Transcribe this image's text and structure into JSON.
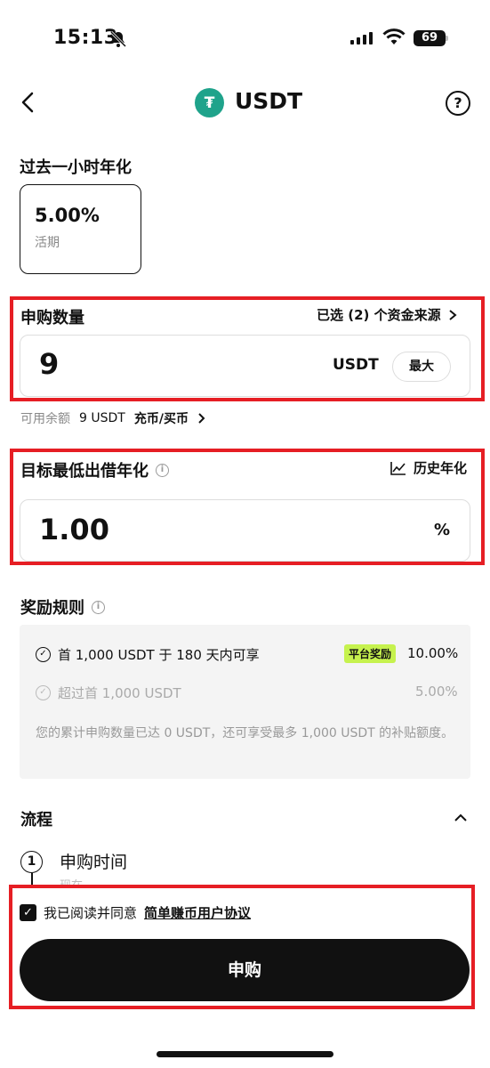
{
  "status_bar": {
    "time": "15:13",
    "battery": "69"
  },
  "header": {
    "title": "USDT",
    "logo_glyph": "₮"
  },
  "rate": {
    "label": "过去一小时年化",
    "value": "5.00%",
    "type": "活期"
  },
  "subscribe": {
    "label": "申购数量",
    "source_link": "已选 (2) 个资金来源",
    "amount": "9",
    "unit": "USDT",
    "max_label": "最大",
    "balance_label": "可用余额",
    "balance_value": "9 USDT",
    "deposit_link": "充币/买币"
  },
  "target": {
    "label": "目标最低出借年化",
    "history_link": "历史年化",
    "value": "1.00",
    "unit": "%"
  },
  "rewards": {
    "label": "奖励规则",
    "row1_text": "首 1,000 USDT 于 180 天内可享",
    "badge": "平台奖励",
    "row1_rate": "10.00%",
    "row2_text": "超过首 1,000 USDT",
    "row2_rate": "5.00%",
    "note": "您的累计申购数量已达 0 USDT，还可享受最多 1,000 USDT 的补贴额度。"
  },
  "flow": {
    "label": "流程",
    "step_number": "1",
    "step_title": "申购时间",
    "step_sub": "现在"
  },
  "agreement": {
    "prefix": "我已阅读并同意",
    "link": "简单赚币用户协议"
  },
  "submit_label": "申购",
  "colors": {
    "accent_red": "#e61e24",
    "token_green": "#1fa38b",
    "badge_green": "#c6f24e"
  }
}
